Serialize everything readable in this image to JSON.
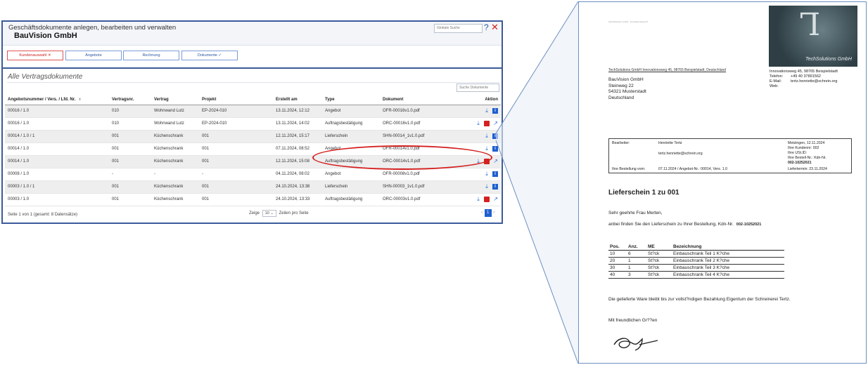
{
  "app": {
    "title": "Geschäftsdokumente anlegen, bearbeiten und verwalten",
    "company": "BauVision GmbH",
    "global_search_placeholder": "Globale Suche",
    "help_symbol": "?",
    "close_symbol": "✕",
    "tabs": [
      {
        "label": "Kundenauswahl ✕"
      },
      {
        "label": "Angebote"
      },
      {
        "label": "Rechnung"
      },
      {
        "label": "Dokumente ✓"
      }
    ],
    "section_title": "Alle Vertragsdokumente",
    "table_search_placeholder": "Suche Dokumente",
    "columns": [
      "Angebotsnummer / Vers. / Lfd. Nr.",
      "Vertragsnr.",
      "Vertrag",
      "Projekt",
      "Erstellt am",
      "Type",
      "Dokument",
      "Aktion"
    ],
    "rows": [
      {
        "nr": "00016 / 1.0",
        "vnr": "010",
        "vertrag": "Wohnwand Lutz",
        "projekt": "EP-2024-010",
        "erstellt": "13.11.2024, 12:12",
        "type": "Angebot",
        "dok": "OFR-00016v1.0.pdf"
      },
      {
        "nr": "00016 / 1.0",
        "vnr": "010",
        "vertrag": "Wohnwand Lutz",
        "projekt": "EP-2024-010",
        "erstellt": "13.11.2024, 14:02",
        "type": "Auftragsbestätigung",
        "dok": "ORC-00016v1.0.pdf"
      },
      {
        "nr": "00014 / 1.0 / 1",
        "vnr": "001",
        "vertrag": "Küchenschrank",
        "projekt": "001",
        "erstellt": "12.11.2024, 15:17",
        "type": "Lieferschein",
        "dok": "SHN-00014_1v1.0.pdf"
      },
      {
        "nr": "00014 / 1.0",
        "vnr": "001",
        "vertrag": "Küchenschrank",
        "projekt": "001",
        "erstellt": "07.11.2024, 08:52",
        "type": "Angebot",
        "dok": "OFR-00014v1.0.pdf"
      },
      {
        "nr": "00014 / 1.0",
        "vnr": "001",
        "vertrag": "Küchenschrank",
        "projekt": "001",
        "erstellt": "12.11.2024, 15:08",
        "type": "Auftragsbestätigung",
        "dok": "ORC-00014v1.0.pdf"
      },
      {
        "nr": "00008 / 1.0",
        "vnr": "-",
        "vertrag": "-",
        "projekt": "-",
        "erstellt": "04.11.2024, 08:02",
        "type": "Angebot",
        "dok": "OFR-00008v1.0.pdf"
      },
      {
        "nr": "00003 / 1.0 / 1",
        "vnr": "001",
        "vertrag": "Küchenschrank",
        "projekt": "001",
        "erstellt": "24.10.2024, 13:38",
        "type": "Lieferschein",
        "dok": "SHN-00003_1v1.0.pdf"
      },
      {
        "nr": "00003 / 1.0",
        "vnr": "001",
        "vertrag": "Küchenschrank",
        "projekt": "001",
        "erstellt": "24.10.2024, 13:33",
        "type": "Auftragsbestätigung",
        "dok": "ORC-00003v1.0.pdf"
      }
    ],
    "footer_info": "Seite 1 von 1 (gesamt: 8 Datensätze)",
    "show_label": "Zeige",
    "page_size": "10",
    "per_page_label": "Zeilen pro Seite",
    "current_page": "1",
    "pager_prev": "‹",
    "pager_next": "›"
  },
  "document": {
    "logo_text": "TechSolutions GmbH",
    "sender_line": "TechSolutions GmbH Innovationsweg 45, 98765 Beispielstadt, Deutschland",
    "tiny_header": "TechSolutions GmbH · Innovationsweg 45",
    "recipient": [
      "BauVision GmbH",
      "Steinweg 22",
      "54321 Musterstadt",
      "Deutschland"
    ],
    "sender_address": "Innovationsweg 45, 98765 Beispielstadt",
    "phone_label": "Telefon:",
    "phone": "+49 40 37891562",
    "email_label": "E-Mail:",
    "email": "tertz.henriette@schrein.org",
    "web_label": "Web:",
    "box": {
      "bearbeiter_label": "Bearbeiter:",
      "bearbeiter": "Henriette Tertz",
      "email": "tertz.henriette@schrein.org",
      "bestellung_label": "Ihre Bestellung vom:",
      "bestellung": "07.11.2024 / Angebot-Nr.: 00014, Vers. 1.0",
      "right": [
        "Metzingen, 12.11.2024",
        "Ihre Kundennr: 002",
        "Ihre USt.ID:",
        "Ihre Bestell-Nr.: Kdn-Nr.",
        "002-10252021",
        "Liefertermin: 23.11.2024"
      ]
    },
    "heading": "Lieferschein 1 zu 001",
    "salutation": "Sehr geehrte Frau Merten,",
    "intro": "anbei finden Sie den Lieferschein zu Ihrer Bestellung, Kdn-Nr.",
    "intro_ref": "002-10252021",
    "pos_columns": [
      "Pos.",
      "Anz.",
      "ME",
      "Bezeichnung"
    ],
    "positions": [
      {
        "pos": "10",
        "anz": "6",
        "me": "St?ck",
        "bez": "Einbauschrank Teil 1 K?che"
      },
      {
        "pos": "20",
        "anz": "1",
        "me": "St?ck",
        "bez": "Einbauschrank Teil 2 K?che"
      },
      {
        "pos": "30",
        "anz": "1",
        "me": "St?ck",
        "bez": "Einbauschrank Teil 3 K?che"
      },
      {
        "pos": "40",
        "anz": "3",
        "me": "St?ck",
        "bez": "Einbauschrank Teil 4 K?che"
      }
    ],
    "retention": "Die gelieferte Ware bleibt bis zur vollst?ndigen Bezahlung Eigentum der Schreinerei Tertz.",
    "closing": "Mit freundlichen Gr??en"
  },
  "colors": {
    "accent": "#3b5a9a",
    "highlight": "#d42020",
    "link": "#2a56a6"
  }
}
